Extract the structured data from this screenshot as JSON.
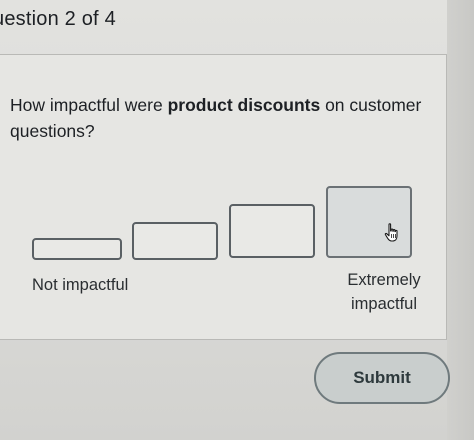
{
  "header": {
    "question_counter": "uestion 2 of 4"
  },
  "question": {
    "text_before": "How impactful were ",
    "text_bold": "product discounts",
    "text_after": " on customer questions?"
  },
  "scale": {
    "options_count": 4,
    "hovered_option": 4,
    "label_low": "Not impactful",
    "label_high": "Extremely impactful"
  },
  "actions": {
    "submit_label": "Submit"
  },
  "icons": {
    "cursor": "hand-pointer-icon"
  },
  "colors": {
    "option_border": "#5a6064",
    "submit_border": "#6f7a7d",
    "submit_bg": "#c9cecd"
  }
}
